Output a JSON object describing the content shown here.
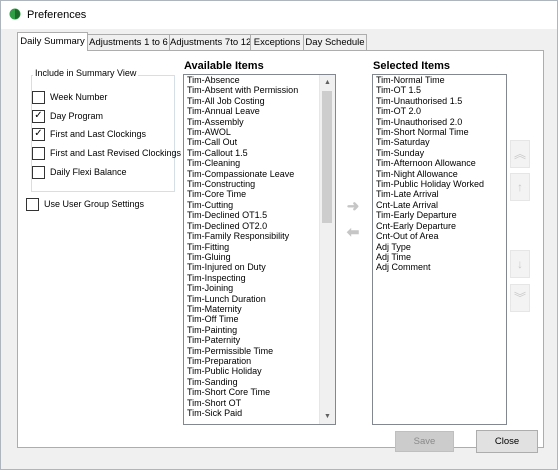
{
  "window": {
    "title": "Preferences"
  },
  "tabs": [
    {
      "label": "Daily Summary",
      "active": true
    },
    {
      "label": "Adjustments 1 to 6",
      "active": false
    },
    {
      "label": "Adjustments 7to 12",
      "active": false
    },
    {
      "label": "Exceptions",
      "active": false
    },
    {
      "label": "Day Schedule",
      "active": false
    }
  ],
  "summary_group": {
    "legend": "Include in Summary View",
    "options": [
      {
        "label": "Week Number",
        "checked": false
      },
      {
        "label": "Day Program",
        "checked": true
      },
      {
        "label": "First and Last Clockings",
        "checked": true
      },
      {
        "label": "First and Last Revised Clockings",
        "checked": false
      },
      {
        "label": "Daily Flexi Balance",
        "checked": false
      }
    ]
  },
  "use_user_group": {
    "label": "Use User Group Settings",
    "checked": false
  },
  "available": {
    "header": "Available Items",
    "items": [
      "Tim-Absence",
      "Tim-Absent with Permission",
      "Tim-All Job Costing",
      "Tim-Annual Leave",
      "Tim-Assembly",
      "Tim-AWOL",
      "Tim-Call Out",
      "Tim-Callout 1.5",
      "Tim-Cleaning",
      "Tim-Compassionate Leave",
      "Tim-Constructing",
      "Tim-Core Time",
      "Tim-Cutting",
      "Tim-Declined OT1.5",
      "Tim-Declined OT2.0",
      "Tim-Family Responsibility",
      "Tim-Fitting",
      "Tim-Gluing",
      "Tim-Injured on Duty",
      "Tim-Inspecting",
      "Tim-Joining",
      "Tim-Lunch Duration",
      "Tim-Maternity",
      "Tim-Off Time",
      "Tim-Painting",
      "Tim-Paternity",
      "Tim-Permissible Time",
      "Tim-Preparation",
      "Tim-Public Holiday",
      "Tim-Sanding",
      "Tim-Short Core Time",
      "Tim-Short OT",
      "Tim-Sick Paid"
    ],
    "scroll_up_icon": "▲",
    "scroll_down_icon": "▼"
  },
  "selected": {
    "header": "Selected Items",
    "items": [
      "Tim-Normal Time",
      "Tim-OT 1.5",
      "Tim-Unauthorised 1.5",
      "Tim-OT 2.0",
      "Tim-Unauthorised 2.0",
      "Tim-Short Normal Time",
      "Tim-Saturday",
      "Tim-Sunday",
      "Tim-Afternoon Allowance",
      "Tim-Night Allowance",
      "Tim-Public Holiday Worked",
      "Tim-Late Arrival",
      "Cnt-Late Arrival",
      "Tim-Early Departure",
      "Cnt-Early Departure",
      "Cnt-Out of Area",
      "Adj Type",
      "Adj Time",
      "Adj Comment"
    ]
  },
  "transfer": {
    "add_icon": "➜",
    "remove_icon": "⬅"
  },
  "ordering": {
    "top_icon": "︽",
    "up_icon": "↑",
    "down_icon": "↓",
    "bottom_icon": "︾"
  },
  "buttons": {
    "save": "Save",
    "close": "Close"
  },
  "colors": {
    "disabled_button": "#cccccc",
    "disabled_text": "#8a8a8a",
    "border": "#adadad"
  }
}
